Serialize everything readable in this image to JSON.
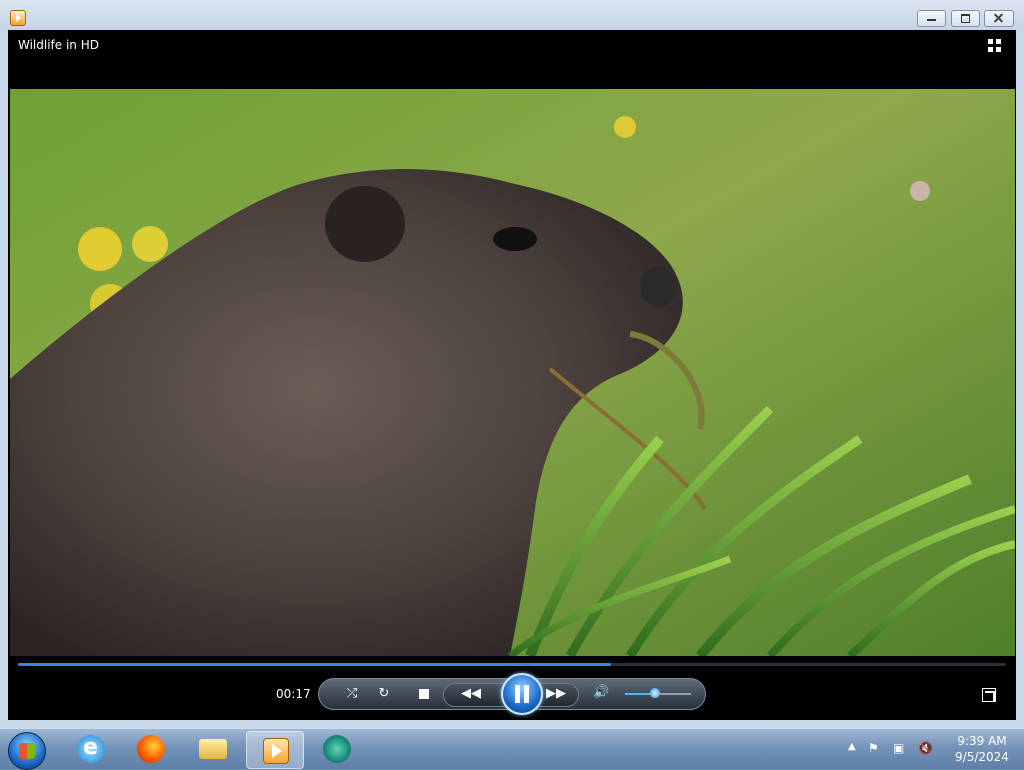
{
  "window": {
    "title": "Wildlife in HD",
    "controls": [
      "minimize",
      "restore",
      "close"
    ]
  },
  "player": {
    "elapsed_time": "00:17",
    "progress_fraction": 0.6,
    "volume_fraction": 0.45,
    "icons": {
      "switch": "switch-to-library-icon",
      "shuffle": "shuffle-icon",
      "repeat": "repeat-icon",
      "stop": "stop-icon",
      "previous": "previous-icon",
      "play_pause": "pause-icon",
      "next": "next-icon",
      "mute": "speaker-icon",
      "fullscreen": "fullscreen-icon"
    }
  },
  "taskbar": {
    "apps": [
      {
        "name": "internet-explorer",
        "active": false
      },
      {
        "name": "firefox",
        "active": false
      },
      {
        "name": "file-explorer",
        "active": false
      },
      {
        "name": "windows-media-player",
        "active": true
      },
      {
        "name": "app-circle",
        "active": false
      }
    ],
    "tray": {
      "clock_time": "9:39 AM",
      "clock_date": "9/5/2024"
    }
  },
  "colors": {
    "accent": "#2d8ae0",
    "taskbar": "#6f8fb3"
  }
}
